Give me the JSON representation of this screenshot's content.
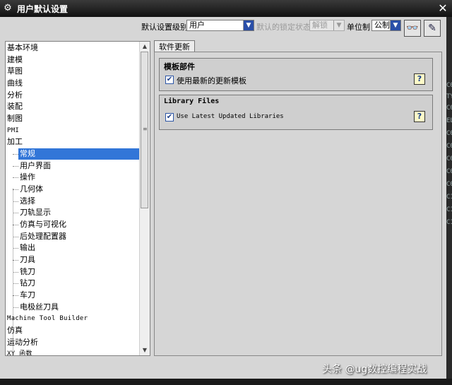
{
  "window": {
    "title": "用户默认设置",
    "app_icon": "gear-icon",
    "close_icon": "close-icon"
  },
  "toolbar": {
    "level_label": "默认设置级别",
    "level_value": "用户",
    "lock_label": "默认的锁定状态",
    "lock_value": "解锁",
    "unit_label": "单位制",
    "unit_value": "公制",
    "tool_button_1_icon": "binoculars-icon",
    "tool_button_2_icon": "manage-icon"
  },
  "tree": {
    "items": [
      {
        "label": "基本环境",
        "level": 0
      },
      {
        "label": "建模",
        "level": 0
      },
      {
        "label": "草图",
        "level": 0
      },
      {
        "label": "曲线",
        "level": 0
      },
      {
        "label": "分析",
        "level": 0
      },
      {
        "label": "装配",
        "level": 0
      },
      {
        "label": "制图",
        "level": 0
      },
      {
        "label": "PMI",
        "level": 0
      },
      {
        "label": "加工",
        "level": 0
      },
      {
        "label": "常规",
        "level": 1,
        "selected": true
      },
      {
        "label": "用户界面",
        "level": 1
      },
      {
        "label": "操作",
        "level": 1
      },
      {
        "label": "几何体",
        "level": 1
      },
      {
        "label": "选择",
        "level": 1
      },
      {
        "label": "刀轨显示",
        "level": 1
      },
      {
        "label": "仿真与可视化",
        "level": 1
      },
      {
        "label": "后处理配置器",
        "level": 1
      },
      {
        "label": "输出",
        "level": 1
      },
      {
        "label": "刀具",
        "level": 1
      },
      {
        "label": "铣刀",
        "level": 1
      },
      {
        "label": "钻刀",
        "level": 1
      },
      {
        "label": "车刀",
        "level": 1
      },
      {
        "label": "电极丝刀具",
        "level": 1
      },
      {
        "label": "Machine Tool Builder",
        "level": 0
      },
      {
        "label": "仿真",
        "level": 0
      },
      {
        "label": "运动分析",
        "level": 0
      },
      {
        "label": "XY 函数",
        "level": 0
      }
    ]
  },
  "tab": {
    "label": "软件更新"
  },
  "groups": {
    "templates": {
      "title": "模板部件",
      "checkbox_label": "使用最新的更新模板",
      "checked": true
    },
    "libraries": {
      "title": "Library Files",
      "checkbox_label": "Use Latest Updated Libraries",
      "checked": true
    }
  },
  "side_fragments": [
    "C0",
    "TY",
    "C0",
    "EL",
    "C0",
    "C0",
    "C0",
    "C0",
    "C0",
    "C1",
    "C1",
    "C1"
  ],
  "watermark": "头条 @ug数控编程实战"
}
